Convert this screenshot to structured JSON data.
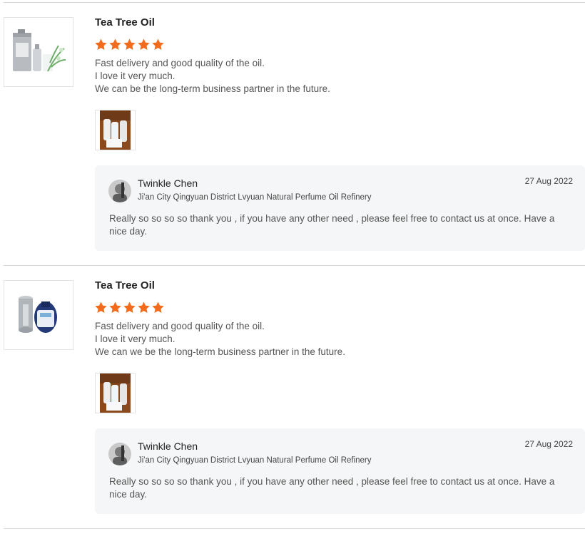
{
  "reviews": [
    {
      "product_title": "Tea Tree Oil",
      "rating": 5,
      "text_lines": [
        "Fast delivery and good quality of the oil.",
        "I love it very much.",
        "We can be the long-term business partner in the future."
      ],
      "reply": {
        "author": "Twinkle Chen",
        "company": "Ji'an City Qingyuan District Lvyuan Natural Perfume Oil Refinery",
        "date": "27 Aug 2022",
        "text": "Really so so so so thank you ,  if you have any other need , please feel free to contact us  at once. Have a nice day."
      }
    },
    {
      "product_title": "Tea Tree Oil",
      "rating": 5,
      "text_lines": [
        "Fast delivery and good quality of the oil.",
        "I love it very much.",
        "We can we be the long-term business partner in the future."
      ],
      "reply": {
        "author": "Twinkle Chen",
        "company": "Ji'an City Qingyuan District Lvyuan Natural Perfume Oil Refinery",
        "date": "27 Aug 2022",
        "text": "Really so so so so thank you ,  if you have any other need , please feel free to contact us  at once. Have a nice day."
      }
    }
  ],
  "colors": {
    "star": "#f36b1c",
    "reply_bg": "#f5f6f7",
    "divider": "#dcdcdc"
  }
}
